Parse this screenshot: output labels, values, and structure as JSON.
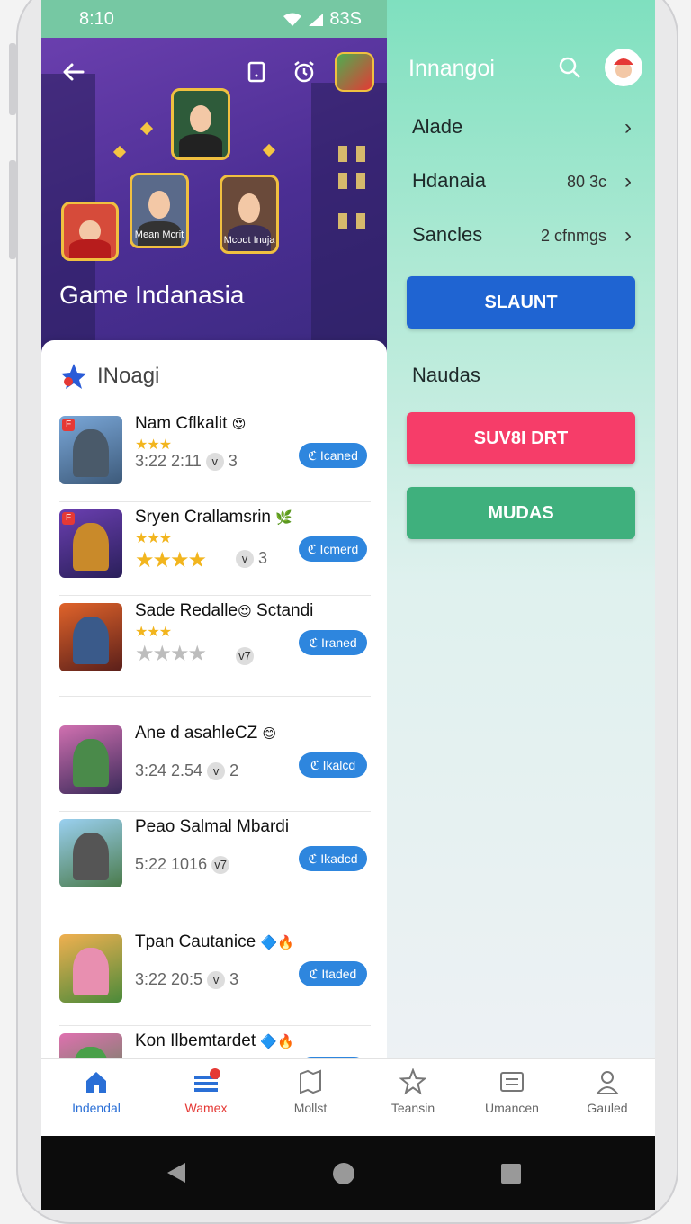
{
  "status": {
    "time": "8:10",
    "battery_text": "83S"
  },
  "hero": {
    "title": "Game Indanasia",
    "card_captions": [
      "Mean Mcrit",
      "Mcoot Inuja"
    ]
  },
  "list": {
    "title": "INoagi",
    "items": [
      {
        "name": "Nam Cflkalit",
        "rating_text": "3:22  2:11",
        "badge": "v",
        "count": "3",
        "button": "Icaned"
      },
      {
        "name": "Sryen Crallamsrin",
        "rating_text": "",
        "badge": "v",
        "count": "3",
        "button": "Icmerd"
      },
      {
        "name": "Sade Redalle",
        "name_suffix": "Sctandi",
        "rating_text": "",
        "badge": "v7",
        "count": "",
        "button": "Iraned"
      },
      {
        "name": "Ane d asahleCZ",
        "rating_text": "3:24  2.54",
        "badge": "v",
        "count": "2",
        "button": "Ikalcd"
      },
      {
        "name": "Peao Salmal Mbardi",
        "rating_text": "5:22  1016",
        "badge": "v7",
        "count": "",
        "button": "Ikadcd"
      },
      {
        "name": "Tpan Cautanice",
        "rating_text": "3:22  20:5",
        "badge": "v",
        "count": "3",
        "button": "Itaded"
      },
      {
        "name": "Kon Ilbemtardet",
        "rating_text": "",
        "badge": "",
        "count": "",
        "button": ""
      }
    ]
  },
  "panel": {
    "title": "Innangoi",
    "items": [
      {
        "label": "Alade",
        "value": ""
      },
      {
        "label": "Hdanaia",
        "value": "80 3c"
      },
      {
        "label": "Sancles",
        "value": "2 cfnmgs"
      }
    ],
    "primary_button": "SLAUNT",
    "section_label": "Naudas",
    "danger_button": "SUV8I DRT",
    "success_button": "MUDAS",
    "colors": {
      "primary": "#1f64d2",
      "danger": "#f63d69",
      "success": "#3fb07d"
    }
  },
  "bottom_nav": [
    {
      "label": "Indendal",
      "icon": "home-icon",
      "active": true
    },
    {
      "label": "Wamex",
      "icon": "menu-icon",
      "active": false
    },
    {
      "label": "Mollst",
      "icon": "map-icon",
      "active": false
    },
    {
      "label": "Teansin",
      "icon": "star-icon",
      "active": false
    },
    {
      "label": "Umancen",
      "icon": "list-icon",
      "active": false
    },
    {
      "label": "Gauled",
      "icon": "profile-icon",
      "active": false
    }
  ]
}
